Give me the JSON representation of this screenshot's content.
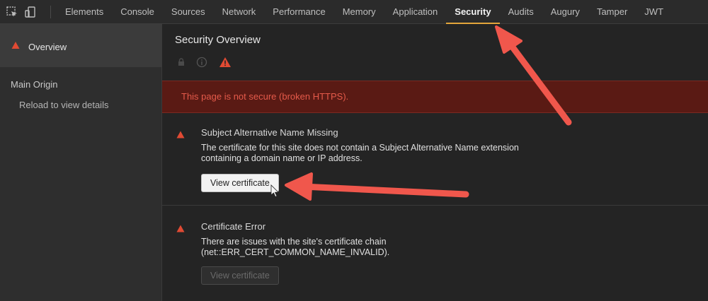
{
  "tabs": [
    {
      "label": "Elements"
    },
    {
      "label": "Console"
    },
    {
      "label": "Sources"
    },
    {
      "label": "Network"
    },
    {
      "label": "Performance"
    },
    {
      "label": "Memory"
    },
    {
      "label": "Application"
    },
    {
      "label": "Security",
      "active": true
    },
    {
      "label": "Audits"
    },
    {
      "label": "Augury"
    },
    {
      "label": "Tamper"
    },
    {
      "label": "JWT"
    }
  ],
  "sidebar": {
    "overview_label": "Overview",
    "main_origin_label": "Main Origin",
    "reload_label": "Reload to view details"
  },
  "main": {
    "title": "Security Overview",
    "banner_text": "This page is not secure (broken HTTPS).",
    "issues": [
      {
        "title": "Subject Alternative Name Missing",
        "description": "The certificate for this site does not contain a Subject Alternative Name extension containing a domain name or IP address.",
        "button_label": "View certificate",
        "button_enabled": true
      },
      {
        "title": "Certificate Error",
        "description": "There are issues with the site's certificate chain (net::ERR_CERT_COMMON_NAME_INVALID).",
        "button_label": "View certificate",
        "button_enabled": false
      }
    ]
  },
  "colors": {
    "accent_tab_underline": "#e3a53b",
    "warning_red": "#e04a33",
    "banner_bg": "#5a1a14",
    "annotation_arrow": "#f0574c"
  },
  "icons": [
    "inspect-element-icon",
    "device-mode-icon",
    "warning-icon",
    "lock-icon",
    "info-icon",
    "cursor-icon"
  ]
}
